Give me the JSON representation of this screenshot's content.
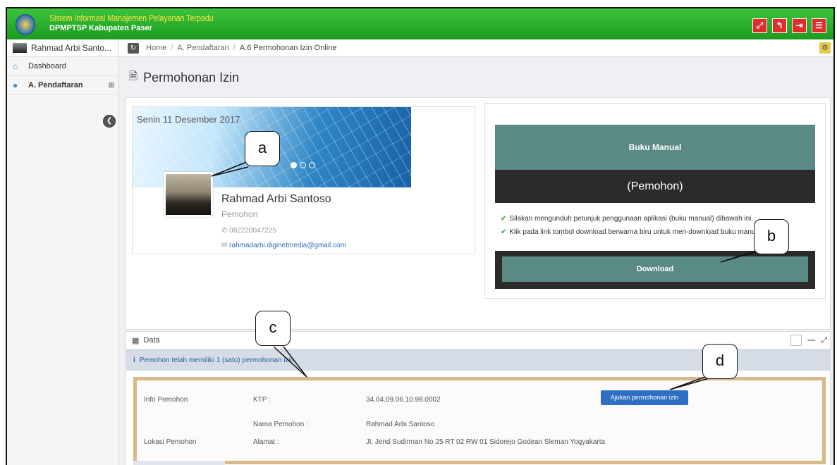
{
  "app": {
    "title": "Sistem Informasi Manajemen Pelayanan Terpadu",
    "subtitle": "DPMPTSP Kabupaten Paser"
  },
  "topbar_buttons": [
    {
      "icon": "fullscreen-icon",
      "glyph": "⤢"
    },
    {
      "icon": "back-icon",
      "glyph": "↰"
    },
    {
      "icon": "logout-icon",
      "glyph": "⇥"
    },
    {
      "icon": "menu-icon",
      "glyph": "☰"
    }
  ],
  "sidebar": {
    "user": "Rahmad Arbi Santo...",
    "items": [
      {
        "label": "Dashboard",
        "icon": "home-icon"
      },
      {
        "label": "A. Pendaftaran",
        "icon": "users-icon"
      }
    ]
  },
  "breadcrumb": {
    "home": "Home",
    "level1": "A. Pendaftaran",
    "current": "A.6 Permohonan Izin Online"
  },
  "page": {
    "title": "Permohonan Izin"
  },
  "profile": {
    "date": "Senin 11 Desember 2017",
    "name": "Rahmad Arbi Santoso",
    "role": "Pemohon",
    "phone": "082220047225",
    "email": "rahmadarbi.diginetmedia@gmail.com"
  },
  "manual": {
    "title": "Buku Manual",
    "subtitle": "(Pemohon)",
    "lines": [
      "Silakan mengunduh petunjuk penggunaan aplikasi (buku manual) dibawah ini.",
      "Klik pada link tombol download berwarna biru untuk men-download buku manual."
    ],
    "download_label": "Download"
  },
  "data_panel": {
    "title": "Data",
    "info": "Pemohon telah memiliki 1 (satu) permohonan izin",
    "rows": {
      "info_label": "Info Pemohon",
      "ktp_label": "KTP :",
      "ktp_value": "34.04.09.06.10.98.0002",
      "nama_label": "Nama Pemohon :",
      "nama_value": "Rahmad Arbi Santoso",
      "lokasi_label": "Lokasi Pemohon",
      "alamat_label": "Alamat :",
      "alamat_value": "Jl. Jend Sudirman No 25 RT 02 RW 01 Sidorejo Godean Sleman Yogyakarta"
    },
    "submit_label": "Ajukan permohonan izin"
  },
  "callouts": {
    "a": "a",
    "b": "b",
    "c": "c",
    "d": "d"
  },
  "colors": {
    "topbar": "#28a92b",
    "teal": "#598a84",
    "dark": "#2b2b2b",
    "primary": "#2d6fc4",
    "highlight_border": "#d9b88a"
  }
}
